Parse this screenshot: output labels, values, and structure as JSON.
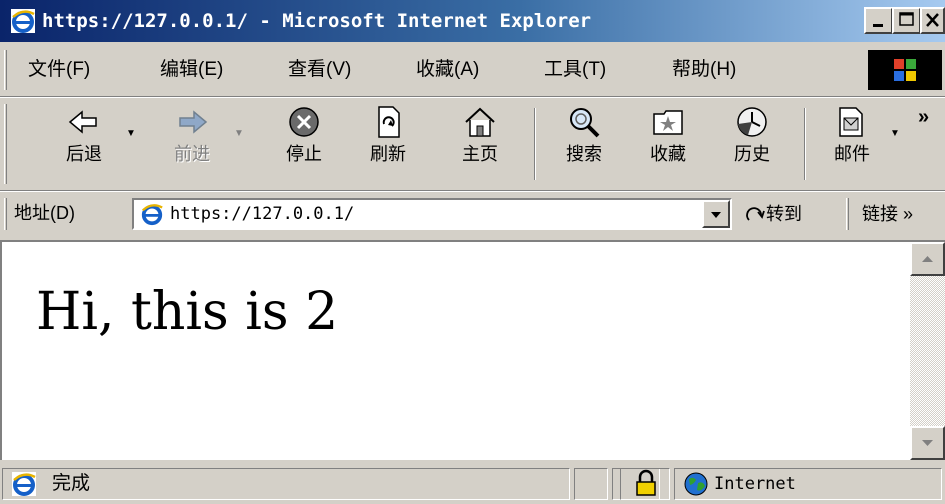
{
  "window": {
    "title": "https://127.0.0.1/ - Microsoft Internet Explorer"
  },
  "menu": {
    "items": [
      "文件(F)",
      "编辑(E)",
      "查看(V)",
      "收藏(A)",
      "工具(T)",
      "帮助(H)"
    ]
  },
  "toolbar": {
    "back": "后退",
    "forward": "前进",
    "stop": "停止",
    "refresh": "刷新",
    "home": "主页",
    "search": "搜索",
    "favorites": "收藏",
    "history": "历史",
    "mail": "邮件",
    "overflow": "»"
  },
  "address": {
    "label": "地址(D)",
    "url": "https://127.0.0.1/",
    "go": "转到",
    "links": "链接 »"
  },
  "page": {
    "body_text": "Hi, this is 2"
  },
  "status": {
    "text": "完成",
    "zone": "Internet"
  },
  "colors": {
    "title_active": "#0a246a",
    "title_gradient_end": "#a6caf0",
    "face": "#d4d0c8",
    "content_bg": "#ffffff"
  },
  "icons": [
    "ie-icon",
    "minimize-icon",
    "maximize-icon",
    "close-icon",
    "windows-logo-icon",
    "back-arrow-icon",
    "forward-arrow-icon",
    "stop-icon",
    "refresh-icon",
    "home-icon",
    "search-icon",
    "favorites-icon",
    "history-icon",
    "mail-icon",
    "go-arrow-icon",
    "lock-icon",
    "globe-icon"
  ]
}
